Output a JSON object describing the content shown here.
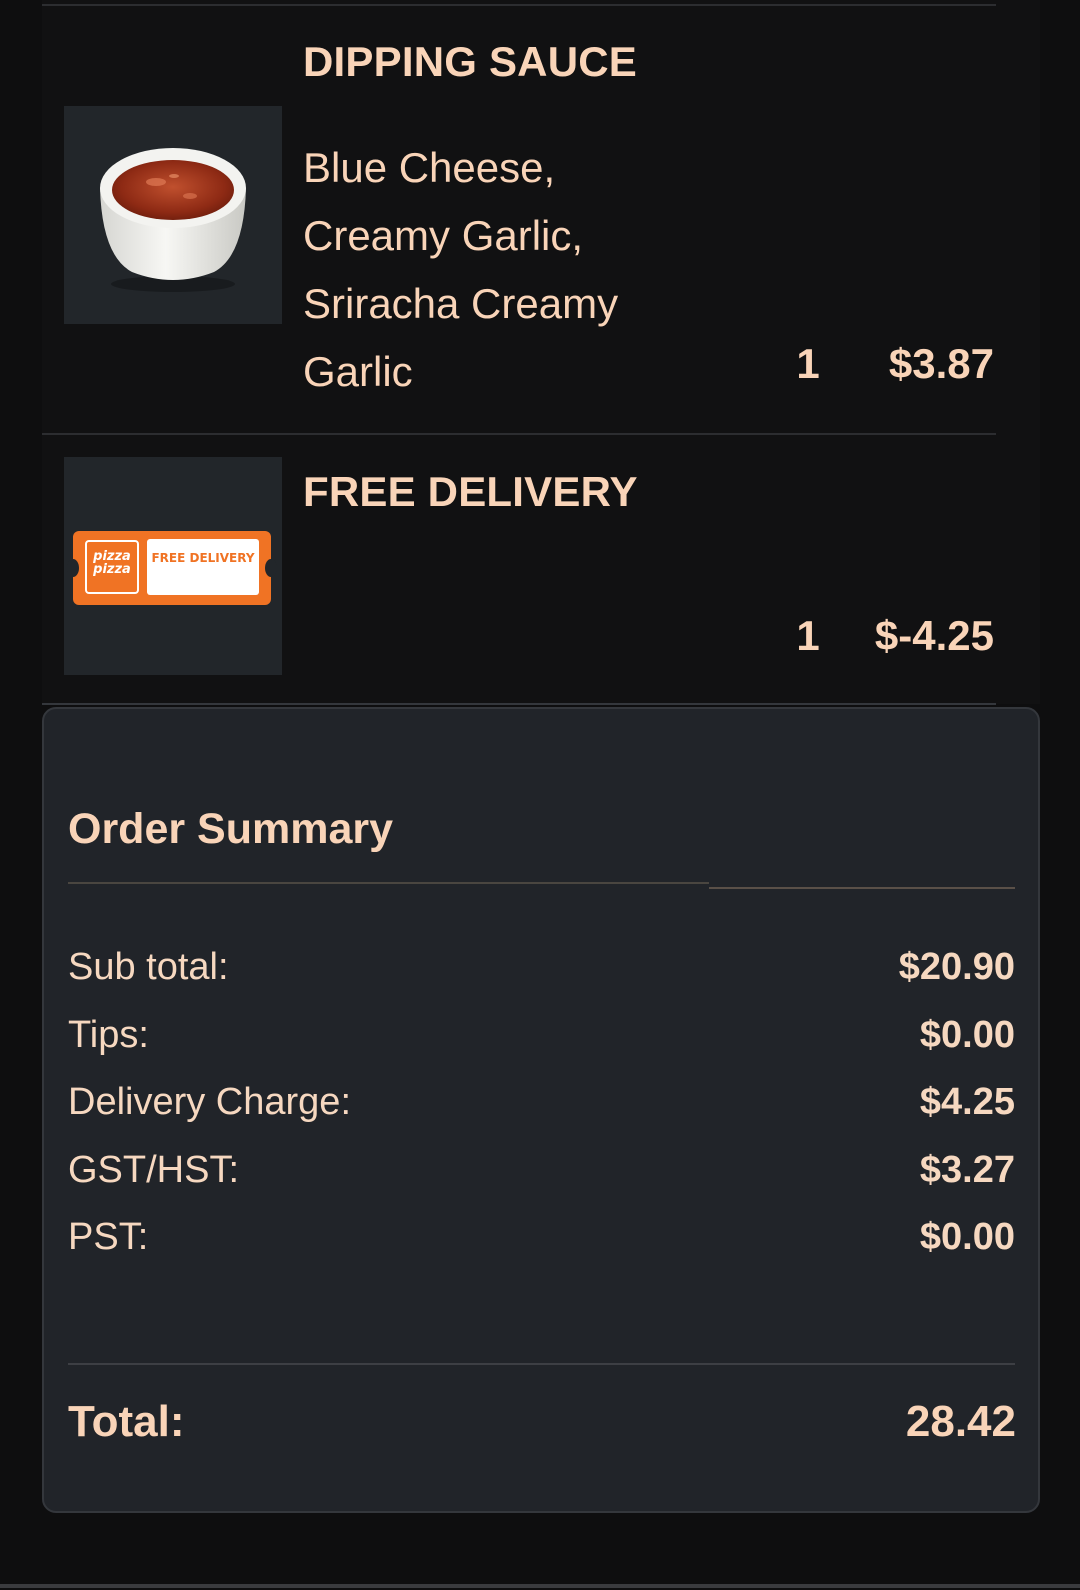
{
  "items": [
    {
      "title": "DIPPING SAUCE",
      "description": "Blue Cheese, Creamy Garlic, Sriracha Creamy Garlic",
      "quantity": "1",
      "price": "$3.87",
      "image": "dipping-sauce-cup"
    },
    {
      "title": "FREE DELIVERY",
      "quantity": "1",
      "price": "$-4.25",
      "image": "free-delivery-coupon",
      "coupon": {
        "logo_text": "pizza pizza",
        "label_text": "FREE DELIVERY"
      }
    }
  ],
  "summary": {
    "title": "Order Summary",
    "rows": [
      {
        "label": "Sub total:",
        "value": "$20.90"
      },
      {
        "label": "Tips:",
        "value": "$0.00"
      },
      {
        "label": "Delivery Charge:",
        "value": "$4.25"
      },
      {
        "label": "GST/HST:",
        "value": "$3.27"
      },
      {
        "label": "PST:",
        "value": "$0.00"
      }
    ],
    "total_label": "Total:",
    "total_value": "28.42"
  },
  "colors": {
    "text_accent": "#f9d4b8",
    "background": "#0e0e0f",
    "card": "#212429",
    "coupon_orange": "#f07324"
  }
}
